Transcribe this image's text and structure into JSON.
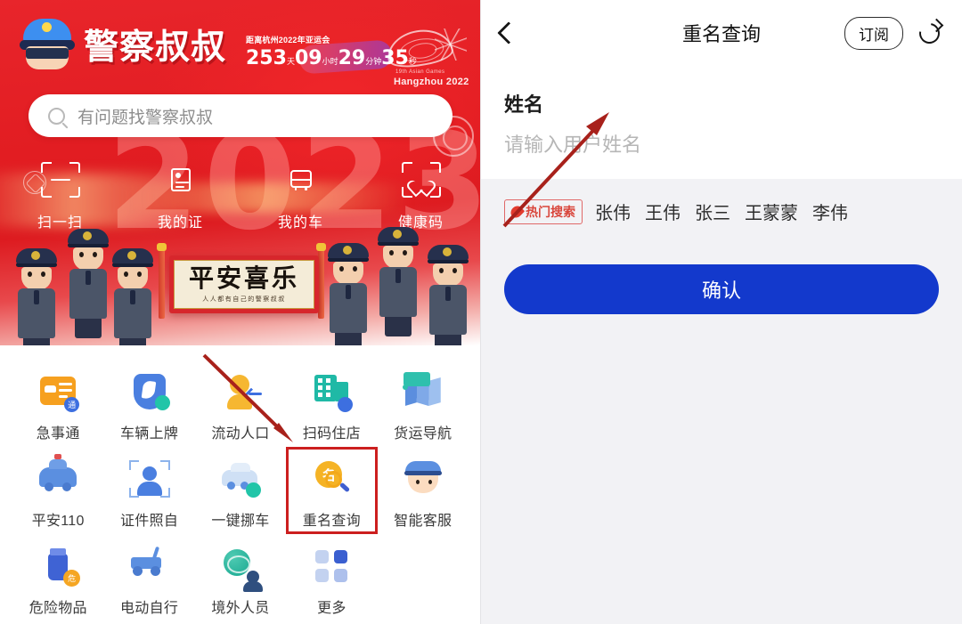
{
  "left": {
    "brand_title": "警察叔叔",
    "countdown": {
      "label": "距离杭州2022年亚运会",
      "days": "253",
      "days_unit": "天",
      "hours": "09",
      "hours_unit": "小时",
      "minutes": "29",
      "minutes_unit": "分钟",
      "seconds": "35",
      "seconds_unit": "秒"
    },
    "asian_games": {
      "line1": "19th Asian Games",
      "line2": "Hangzhou 2022"
    },
    "hero_year": "2023",
    "search": {
      "placeholder": "有问题找警察叔叔",
      "icon": "search-icon"
    },
    "quick_actions": [
      {
        "label": "扫一扫",
        "icon": "scan-frame-icon"
      },
      {
        "label": "我的证",
        "icon": "id-card-icon"
      },
      {
        "label": "我的车",
        "icon": "vehicle-icon"
      },
      {
        "label": "健康码",
        "icon": "health-code-heart-icon"
      }
    ],
    "banner": {
      "main": "平安喜乐",
      "sub": "人人都有自己的警察叔叔"
    },
    "app_grid": [
      [
        {
          "label": "急事通",
          "icon": "urgent-doc-icon",
          "badge": "通",
          "highlight": false
        },
        {
          "label": "车辆上牌",
          "icon": "vehicle-plate-shield-icon",
          "badge": "",
          "highlight": false
        },
        {
          "label": "流动人口",
          "icon": "floating-population-icon",
          "badge": "",
          "highlight": false
        },
        {
          "label": "扫码住店",
          "icon": "scan-hotel-building-icon",
          "badge": "",
          "highlight": false
        },
        {
          "label": "货运导航",
          "icon": "freight-navigation-map-icon",
          "badge": "",
          "highlight": false
        }
      ],
      [
        {
          "label": "平安110",
          "icon": "police-car-icon",
          "badge": "",
          "highlight": false
        },
        {
          "label": "证件照自",
          "icon": "id-photo-frame-icon",
          "badge": "",
          "highlight": false
        },
        {
          "label": "一键挪车",
          "icon": "move-car-icon",
          "badge": "",
          "highlight": false
        },
        {
          "label": "重名查询",
          "icon": "duplicate-name-search-icon",
          "badge": "名",
          "highlight": true
        },
        {
          "label": "智能客服",
          "icon": "smart-service-officer-icon",
          "badge": "",
          "highlight": false
        }
      ],
      [
        {
          "label": "危险物品",
          "icon": "dangerous-goods-bottle-icon",
          "badge": "危",
          "highlight": false
        },
        {
          "label": "电动自行",
          "icon": "e-bike-scooter-icon",
          "badge": "",
          "highlight": false
        },
        {
          "label": "境外人员",
          "icon": "foreigner-globe-icon",
          "badge": "",
          "highlight": false
        },
        {
          "label": "更多",
          "icon": "more-grid-icon",
          "badge": "",
          "highlight": false
        }
      ]
    ]
  },
  "right": {
    "header": {
      "back_icon": "back-chevron-icon",
      "title": "重名查询",
      "subscribe_label": "订阅",
      "share_icon": "share-icon"
    },
    "form": {
      "name_label": "姓名",
      "name_value": "",
      "name_placeholder": "请输入用户姓名"
    },
    "hot_search": {
      "badge_label": "热门搜索",
      "flame_icon": "flame-icon",
      "tags": [
        "张伟",
        "王伟",
        "张三",
        "王蒙蒙",
        "李伟"
      ]
    },
    "confirm_label": "确认"
  },
  "colors": {
    "hero_red": "#e21d22",
    "primary_blue": "#1339cc",
    "highlight_red": "#cc1f1f",
    "annotation_red": "#a8211b",
    "panel_bg": "#f2f2f5"
  }
}
